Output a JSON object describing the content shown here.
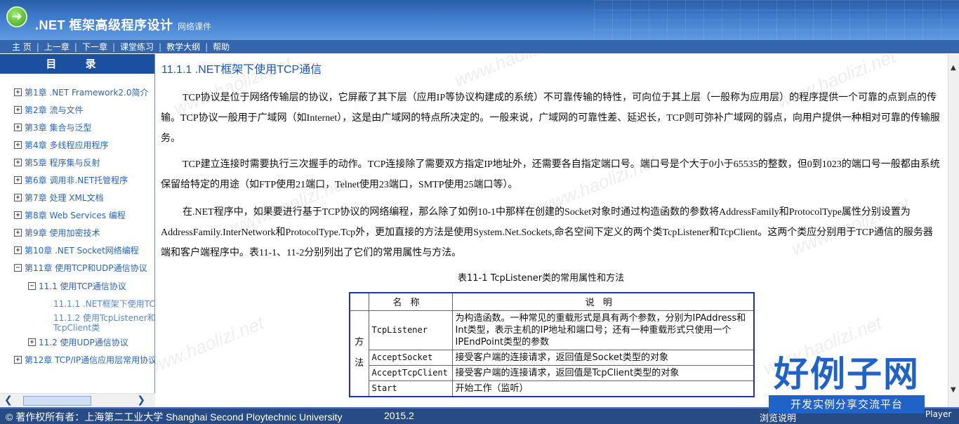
{
  "header": {
    "title": ".NET 框架高级程序设计",
    "subtitle": "网络课件"
  },
  "nav": {
    "items": [
      "主 页",
      "上一章",
      "下一章",
      "课堂练习",
      "教学大纲",
      "帮助"
    ]
  },
  "sidebar": {
    "title": "目 录",
    "items": [
      {
        "toggle": "+",
        "label": "第1章 .NET Framework2.0简介"
      },
      {
        "toggle": "+",
        "label": "第2章 流与文件"
      },
      {
        "toggle": "+",
        "label": "第3章 集合与泛型"
      },
      {
        "toggle": "+",
        "label": "第4章 多线程应用程序"
      },
      {
        "toggle": "+",
        "label": "第5章 程序集与反射"
      },
      {
        "toggle": "+",
        "label": "第6章 调用非.NET托管程序"
      },
      {
        "toggle": "+",
        "label": "第7章 处理 XML文档"
      },
      {
        "toggle": "+",
        "label": "第8章 Web Services 编程"
      },
      {
        "toggle": "+",
        "label": "第9章 使用加密技术"
      },
      {
        "toggle": "+",
        "label": "第10章 .NET Socket网络编程"
      },
      {
        "toggle": "−",
        "label": "第11章 使用TCP和UDP通信协议"
      },
      {
        "toggle": "−",
        "label": "11.1 使用TCP通信协议"
      },
      {
        "toggle": "",
        "label": "11.1.1 .NET框架下使用TCP通信"
      },
      {
        "toggle": "",
        "label": "11.1.2 使用TcpListener和TcpClient类"
      },
      {
        "toggle": "+",
        "label": "11.2 使用UDP通信协议"
      },
      {
        "toggle": "+",
        "label": "第12章 TCP/IP通信应用层常用协议"
      }
    ]
  },
  "content": {
    "section_title": "11.1.1 .NET框架下使用TCP通信",
    "paragraphs": [
      "TCP协议是位于网络传输层的协议，它屏蔽了其下层（应用IP等协议构建成的系统）不可靠传输的特性，可向位于其上层（一般称为应用层）的程序提供一个可靠的点到点的传输。TCP协议一般用于广域网（如Internet），这是由广域网的特点所决定的。一般来说，广域网的可靠性差、延迟长，TCP则可弥补广域网的弱点，向用户提供一种相对可靠的传输服务。",
      "TCP建立连接时需要执行三次握手的动作。TCP连接除了需要双方指定IP地址外，还需要各自指定端口号。端口号是个大于0小于65535的整数，但0到1023的端口号一般都由系统保留给特定的用途（如FTP使用21端口，Telnet使用23端口，SMTP使用25端口等）。",
      "在.NET程序中，如果要进行基于TCP协议的网络编程，那么除了如例10-1中那样在创建的Socket对象时通过构造函数的参数将AddressFamily和ProtocolType属性分别设置为AddressFamily.InterNetwork和ProtocolType.Tcp外，更加直接的方法是使用System.Net.Sockets,命名空间下定义的两个类TcpListener和TcpClient。这两个类应分别用于TCP通信的服务器端和客户端程序中。表11-1、11-2分别列出了它们的常用属性与方法。"
    ],
    "table": {
      "caption": "表11-1 TcpListener类的常用属性和方法",
      "headers": [
        "名称",
        "说明"
      ],
      "category": "方法",
      "rows": [
        {
          "name": "TcpListener",
          "desc": "为构造函数。一种常见的重载形式是具有两个参数，分别为IPAddress和Int类型，表示主机的IP地址和端口号；还有一种重载形式只使用一个IPEndPoint类型的参数"
        },
        {
          "name": "AcceptSocket",
          "desc": "接受客户端的连接请求，返回值是Socket类型的对象"
        },
        {
          "name": "AcceptTcpClient",
          "desc": "接受客户端的连接请求，返回值是TcpClient类型的对象"
        },
        {
          "name": "Start",
          "desc": "开始工作（监听）"
        }
      ]
    }
  },
  "watermark": "www.haolizi.net",
  "footer": {
    "copyright": "© 著作权所有者：上海第二工业大学 Shanghai Second Ploytechnic University",
    "year": "2015.2",
    "right_text": "浏览说明",
    "player": "Player"
  },
  "brand": {
    "main": "好例子网",
    "sub": "开发实例分享交流平台"
  },
  "colors": {
    "header_blue": "#2a5ea8",
    "nav_blue": "#3466ad",
    "toc_header": "#1b4fa0",
    "link_blue": "#2a66b8",
    "title_blue": "#1a55c8",
    "brand_blue": "#1f62c8"
  }
}
